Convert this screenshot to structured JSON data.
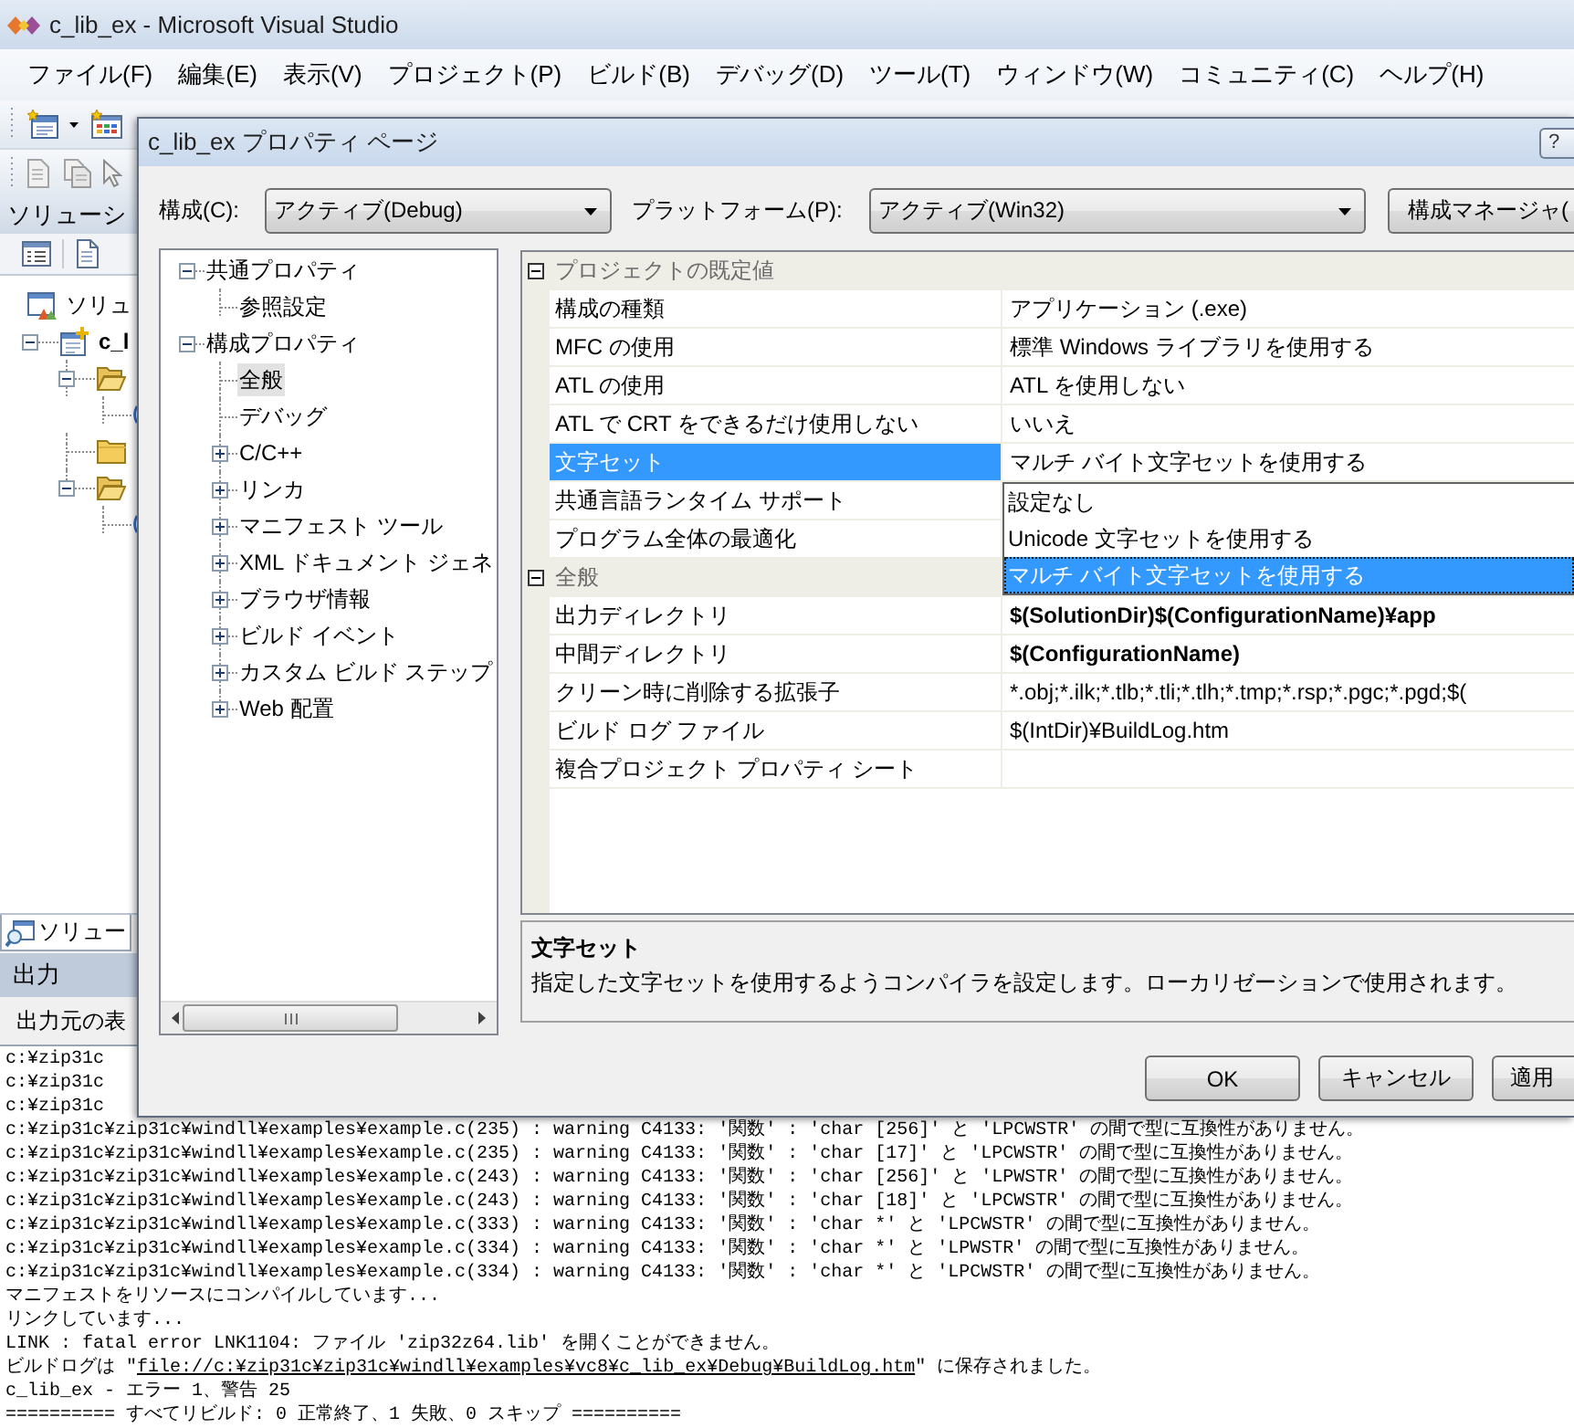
{
  "window": {
    "title": "c_lib_ex - Microsoft Visual Studio"
  },
  "menu": [
    "ファイル(F)",
    "編集(E)",
    "表示(V)",
    "プロジェクト(P)",
    "ビルド(B)",
    "デバッグ(D)",
    "ツール(T)",
    "ウィンドウ(W)",
    "コミュニティ(C)",
    "ヘルプ(H)"
  ],
  "solution_explorer": {
    "title": "ソリューシ",
    "tree": [
      {
        "kind": "solution",
        "label": "ソリュ",
        "children": [
          {
            "kind": "project",
            "label": "c_l",
            "startup": true,
            "expanded": true,
            "children": [
              {
                "kind": "folder",
                "expanded": true,
                "children": [
                  {
                    "kind": "file"
                  }
                ]
              },
              {
                "kind": "folder"
              },
              {
                "kind": "folder",
                "expanded": true,
                "children": [
                  {
                    "kind": "file"
                  }
                ]
              }
            ]
          }
        ]
      }
    ],
    "tab": "ソリュー"
  },
  "output": {
    "title": "出力",
    "source_label": "出力元の表",
    "lines": [
      {
        "kind": "text",
        "text": "c:¥zip31c"
      },
      {
        "kind": "text",
        "text": "c:¥zip31c"
      },
      {
        "kind": "text",
        "text": "c:¥zip31c"
      },
      {
        "kind": "text",
        "text": "c:¥zip31c¥zip31c¥windll¥examples¥example.c(235) : warning C4133: '関数' : 'char [256]' と 'LPCWSTR' の間で型に互換性がありません。"
      },
      {
        "kind": "text",
        "text": "c:¥zip31c¥zip31c¥windll¥examples¥example.c(235) : warning C4133: '関数' : 'char [17]' と 'LPCWSTR' の間で型に互換性がありません。"
      },
      {
        "kind": "text",
        "text": "c:¥zip31c¥zip31c¥windll¥examples¥example.c(243) : warning C4133: '関数' : 'char [256]' と 'LPWSTR' の間で型に互換性がありません。"
      },
      {
        "kind": "text",
        "text": "c:¥zip31c¥zip31c¥windll¥examples¥example.c(243) : warning C4133: '関数' : 'char [18]' と 'LPCWSTR' の間で型に互換性がありません。"
      },
      {
        "kind": "text",
        "text": "c:¥zip31c¥zip31c¥windll¥examples¥example.c(333) : warning C4133: '関数' : 'char *' と 'LPCWSTR' の間で型に互換性がありません。"
      },
      {
        "kind": "text",
        "text": "c:¥zip31c¥zip31c¥windll¥examples¥example.c(334) : warning C4133: '関数' : 'char *' と 'LPWSTR' の間で型に互換性がありません。"
      },
      {
        "kind": "text",
        "text": "c:¥zip31c¥zip31c¥windll¥examples¥example.c(334) : warning C4133: '関数' : 'char *' と 'LPCWSTR' の間で型に互換性がありません。"
      },
      {
        "kind": "text",
        "text": "マニフェストをリソースにコンパイルしています..."
      },
      {
        "kind": "text",
        "text": "リンクしています..."
      },
      {
        "kind": "text",
        "text": "LINK : fatal error LNK1104: ファイル 'zip32z64.lib' を開くことができません。"
      },
      {
        "kind": "link",
        "before": "ビルドログは \"",
        "link": "file://c:¥zip31c¥zip31c¥windll¥examples¥vc8¥c_lib_ex¥Debug¥BuildLog.htm",
        "after": "\" に保存されました。"
      },
      {
        "kind": "text",
        "text": "c_lib_ex - エラー 1、警告 25"
      },
      {
        "kind": "text",
        "text": "========== すべてリビルド: 0 正常終了、1 失敗、0 スキップ =========="
      }
    ]
  },
  "dialog": {
    "title": "c_lib_ex プロパティ ページ",
    "help_button": "?",
    "configuration": {
      "label": "構成(C):",
      "value": "アクティブ(Debug)"
    },
    "platform": {
      "label": "プラットフォーム(P):",
      "value": "アクティブ(Win32)"
    },
    "manager_button": "構成マネージャ(",
    "tree": [
      {
        "label": "共通プロパティ",
        "expanded": true,
        "selected": false,
        "children": [
          {
            "label": "参照設定",
            "selected": false
          }
        ]
      },
      {
        "label": "構成プロパティ",
        "expanded": true,
        "selected": false,
        "children": [
          {
            "label": "全般",
            "selected": true
          },
          {
            "label": "デバッグ",
            "selected": false
          },
          {
            "label": "C/C++",
            "expanded": false,
            "selected": false
          },
          {
            "label": "リンカ",
            "expanded": false,
            "selected": false
          },
          {
            "label": "マニフェスト ツール",
            "expanded": false,
            "selected": false
          },
          {
            "label": "XML ドキュメント ジェネ",
            "expanded": false,
            "selected": false
          },
          {
            "label": "ブラウザ情報",
            "expanded": false,
            "selected": false
          },
          {
            "label": "ビルド イベント",
            "expanded": false,
            "selected": false
          },
          {
            "label": "カスタム ビルド ステップ",
            "expanded": false,
            "selected": false
          },
          {
            "label": "Web 配置",
            "expanded": false,
            "selected": false
          }
        ]
      }
    ],
    "grid": [
      {
        "title": "プロジェクトの既定値",
        "expanded": true,
        "rows": [
          {
            "name": "構成の種類",
            "value": "アプリケーション (.exe)",
            "modified": false,
            "selected": false
          },
          {
            "name": "MFC の使用",
            "value": "標準 Windows ライブラリを使用する",
            "modified": false,
            "selected": false
          },
          {
            "name": "ATL の使用",
            "value": "ATL を使用しない",
            "modified": false,
            "selected": false
          },
          {
            "name": "ATL で CRT をできるだけ使用しない",
            "value": "いいえ",
            "modified": false,
            "selected": false
          },
          {
            "name": "文字セット",
            "value": "マルチ バイト文字セットを使用する",
            "modified": false,
            "selected": true,
            "options": [
              {
                "label": "設定なし",
                "selected": false
              },
              {
                "label": "Unicode 文字セットを使用する",
                "selected": false
              },
              {
                "label": "マルチ バイト文字セットを使用する",
                "selected": true
              }
            ]
          },
          {
            "name": "共通言語ランタイム サポート",
            "selected": false
          },
          {
            "name": "プログラム全体の最適化",
            "selected": false
          }
        ]
      },
      {
        "title": "全般",
        "expanded": true,
        "rows": [
          {
            "name": "出力ディレクトリ",
            "value": "$(SolutionDir)$(ConfigurationName)¥app",
            "modified": true,
            "selected": false
          },
          {
            "name": "中間ディレクトリ",
            "value": "$(ConfigurationName)",
            "modified": true,
            "selected": false
          },
          {
            "name": "クリーン時に削除する拡張子",
            "value": "*.obj;*.ilk;*.tlb;*.tli;*.tlh;*.tmp;*.rsp;*.pgc;*.pgd;$(",
            "modified": false,
            "selected": false
          },
          {
            "name": "ビルド ログ ファイル",
            "value": "$(IntDir)¥BuildLog.htm",
            "modified": false,
            "selected": false
          },
          {
            "name": "複合プロジェクト プロパティ シート",
            "selected": false
          }
        ]
      }
    ],
    "description": {
      "title": "文字セット",
      "text": "指定した文字セットを使用するようコンパイラを設定します。ローカリゼーションで使用されます。"
    },
    "buttons": [
      "OK",
      "キャンセル",
      "適用"
    ]
  }
}
